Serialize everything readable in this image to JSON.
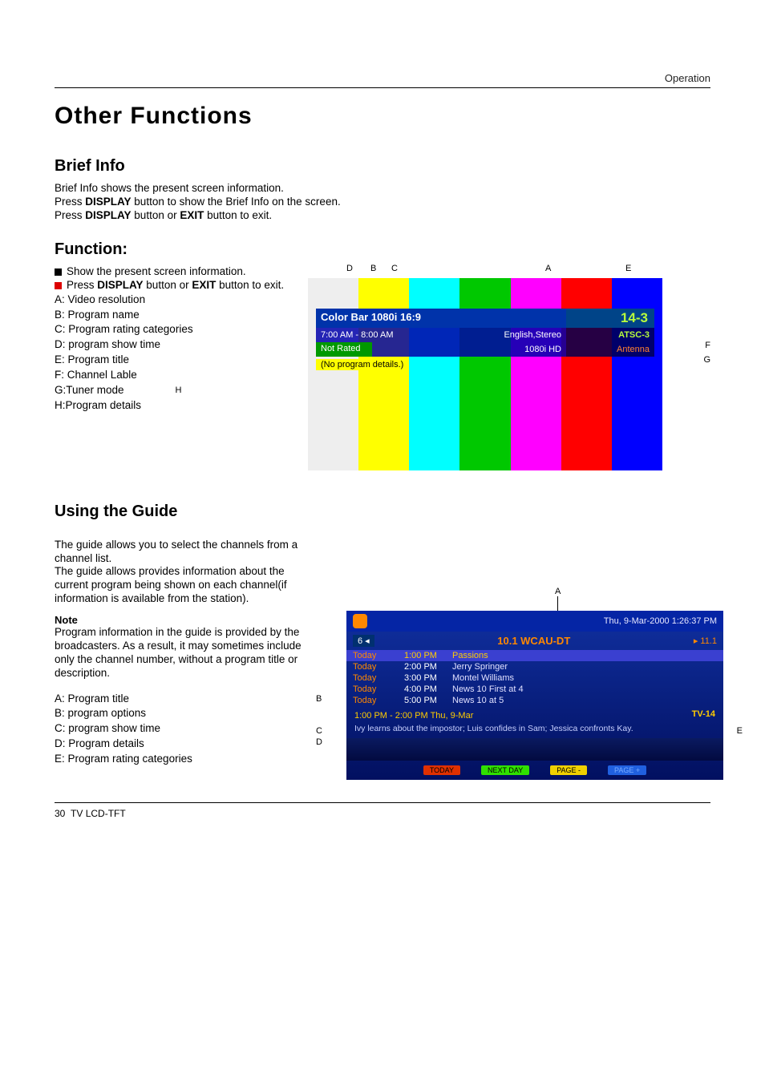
{
  "header": {
    "section": "Operation"
  },
  "title": "Other Functions",
  "brief_info": {
    "heading": "Brief Info",
    "p1": "Brief Info shows the present screen information.",
    "p2a": "Press ",
    "p2b": "DISPLAY",
    "p2c": " button to show the Brief Info on the screen.",
    "p3a": "Press ",
    "p3b": "DISPLAY",
    "p3c": " button or ",
    "p3d": "EXIT",
    "p3e": " button to exit."
  },
  "function": {
    "heading": "Function:",
    "b1": "Show the present screen information.",
    "b2a": "Press ",
    "b2b": "DISPLAY",
    "b2c": " button or ",
    "b2d": "EXIT",
    "b2e": " button to exit.",
    "legend": {
      "A": "A: Video resolution",
      "B": "B: Program name",
      "C": "C: Program rating categories",
      "D": "D: program show time",
      "E": "E: Program title",
      "F": "F: Channel Lable",
      "G": "G:Tuner mode",
      "H": "H:Program details"
    },
    "callouts": {
      "D": "D",
      "B": "B",
      "C": "C",
      "A": "A",
      "E": "E",
      "F": "F",
      "G": "G",
      "H": "H"
    }
  },
  "osd": {
    "title_left": "Color Bar 1080i 16:9",
    "title_right": "14-3",
    "time": "7:00 AM - 8:00 AM",
    "audio": "English,Stereo",
    "label": "ATSC-3",
    "rating": "Not Rated",
    "res": "1080i HD",
    "tuner": "Antenna",
    "details": "(No program details.)"
  },
  "guide_section": {
    "heading": "Using the Guide",
    "p1": "The guide allows you to select the channels from a channel list.",
    "p2": "The guide allows provides information about the current program being shown on each channel(if information is available from the station).",
    "note_h": "Note",
    "note": "Program information in the guide is provided by the broadcasters. As a result, it may sometimes include only the channel number, without a program title or description.",
    "legend": {
      "A": "A:  Program title",
      "B": "B:  program options",
      "C": "C:  program show time",
      "D": "D:  Program details",
      "E": "E:  Program rating categories"
    },
    "callouts": {
      "A": "A",
      "B": "B",
      "C": "C",
      "D": "D",
      "E": "E"
    }
  },
  "guide": {
    "datetime": "Thu, 9-Mar-2000  1:26:37 PM",
    "ch_num": "6",
    "ch_name": "10.1  WCAU-DT",
    "ch_pos": "▸ 11.1",
    "rows": [
      {
        "day": "Today",
        "time": "1:00 PM",
        "title": "Passions",
        "hl": true
      },
      {
        "day": "Today",
        "time": "2:00 PM",
        "title": "Jerry Springer",
        "hl": false
      },
      {
        "day": "Today",
        "time": "3:00 PM",
        "title": "Montel Williams",
        "hl": false
      },
      {
        "day": "Today",
        "time": "4:00 PM",
        "title": "News 10 First at 4",
        "hl": false
      },
      {
        "day": "Today",
        "time": "5:00 PM",
        "title": "News 10 at 5",
        "hl": false
      }
    ],
    "detail_time": "1:00 PM - 2:00 PM  Thu, 9-Mar",
    "rating": "TV-14",
    "desc": "Ivy learns about the impostor; Luis confides in Sam; Jessica confronts Kay.",
    "btns": {
      "red": "TODAY",
      "green": "NEXT DAY",
      "yellow": "PAGE -",
      "blue": "PAGE +"
    }
  },
  "footer": {
    "page": "30",
    "model": "TV LCD-TFT"
  }
}
